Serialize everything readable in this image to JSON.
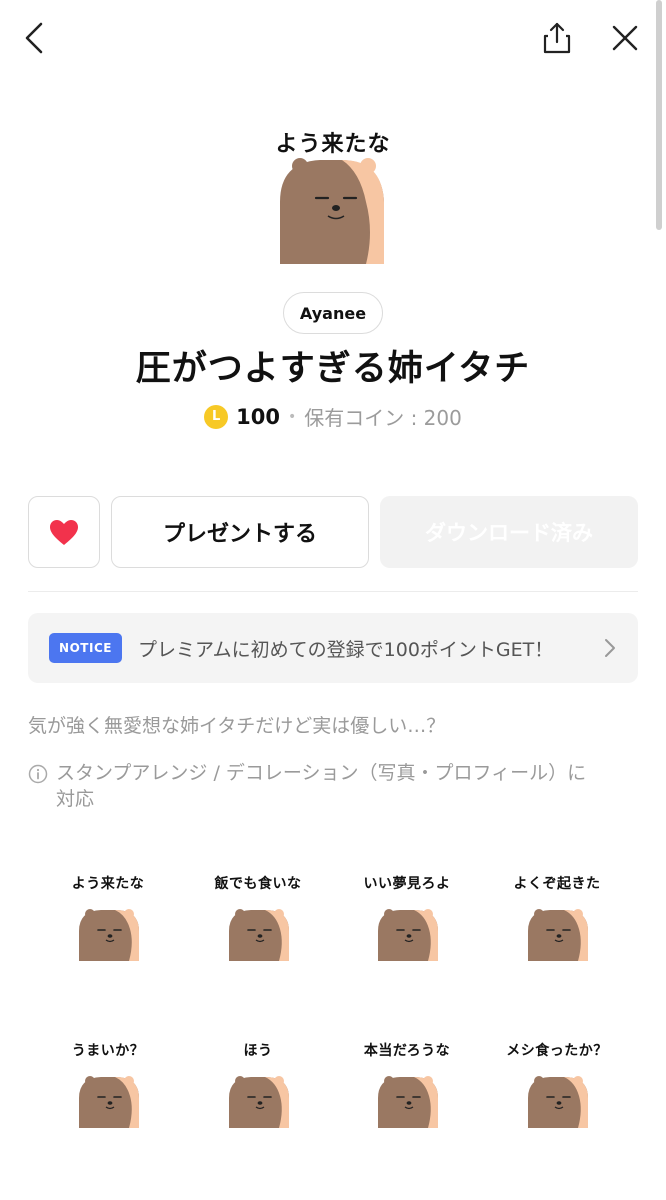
{
  "topbar": {
    "back_icon": "chevron-left-icon",
    "share_icon": "share-icon",
    "close_icon": "close-icon"
  },
  "hero": {
    "caption": "よう来たな"
  },
  "creator": "Ayanee",
  "title": "圧がつよすぎる姉イタチ",
  "price": {
    "coin_letter": "L",
    "amount": "100",
    "owned_label": "保有コイン : 200"
  },
  "buttons": {
    "like_icon": "heart-icon",
    "present": "プレゼントする",
    "download": "ダウンロード済み"
  },
  "notice": {
    "badge": "NOTICE",
    "text": "プレミアムに初めての登録で100ポイントGET！"
  },
  "description": "気が強く無愛想な姉イタチだけど実は優しい…？",
  "compat": {
    "icon": "info-icon",
    "line1": "スタンプアレンジ / デコレーション（写真・プロフィール）に",
    "line2": "対応"
  },
  "stickers": [
    "よう来たな",
    "飯でも食いな",
    "いい夢見ろよ",
    "よくぞ起きた",
    "うまいか？",
    "ほう",
    "本当だろうな",
    "メシ食ったか？"
  ],
  "colors": {
    "accent_notice": "#4c76f0",
    "heart": "#f2324c",
    "coin": "#f7c926"
  }
}
